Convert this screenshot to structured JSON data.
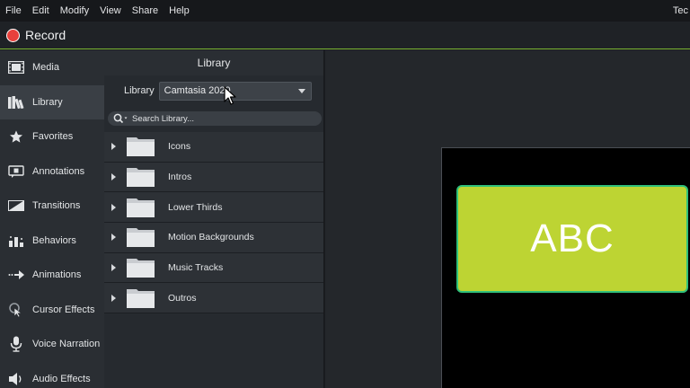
{
  "menu": {
    "items": [
      "File",
      "Edit",
      "Modify",
      "View",
      "Share",
      "Help"
    ],
    "app_title": "Tec"
  },
  "record": {
    "label": "Record",
    "dot_color": "#e8413c",
    "accent_line_color": "#7bb531"
  },
  "sidebar": {
    "items": [
      {
        "label": "Media",
        "icon": "film-icon"
      },
      {
        "label": "Library",
        "icon": "books-icon",
        "active": true
      },
      {
        "label": "Favorites",
        "icon": "star-icon"
      },
      {
        "label": "Annotations",
        "icon": "annotation-icon"
      },
      {
        "label": "Transitions",
        "icon": "transition-icon"
      },
      {
        "label": "Behaviors",
        "icon": "behaviors-icon"
      },
      {
        "label": "Animations",
        "icon": "animation-arrow-icon"
      },
      {
        "label": "Cursor Effects",
        "icon": "cursor-effects-icon"
      },
      {
        "label": "Voice Narration",
        "icon": "microphone-icon"
      },
      {
        "label": "Audio Effects",
        "icon": "speaker-icon"
      }
    ]
  },
  "library": {
    "title": "Library",
    "select_label": "Library",
    "selected": "Camtasia 2020",
    "search_placeholder": "Search Library...",
    "folders": [
      "Icons",
      "Intros",
      "Lower Thirds",
      "Motion Backgrounds",
      "Music Tracks",
      "Outros"
    ]
  },
  "canvas": {
    "media_text": "ABC",
    "media_color": "#bdd433",
    "media_border_color": "#2fc07a"
  }
}
